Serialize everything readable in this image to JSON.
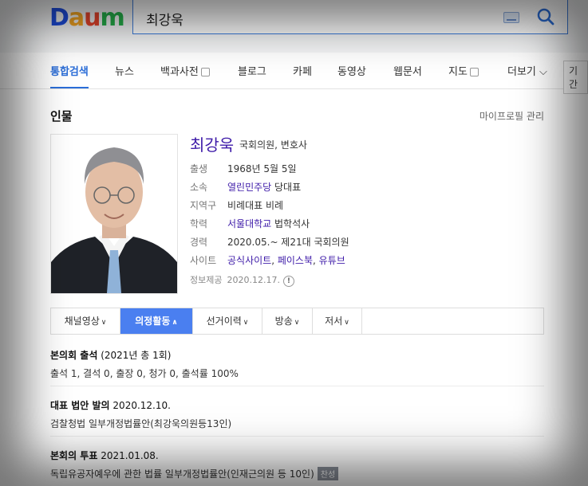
{
  "logo": {
    "letters": [
      "D",
      "a",
      "u",
      "m"
    ],
    "colors": [
      "#1e4ee0",
      "#f5a623",
      "#e8452c",
      "#26b14b"
    ]
  },
  "search": {
    "query": "최강욱"
  },
  "tabs": [
    {
      "label": "통합검색"
    },
    {
      "label": "뉴스"
    },
    {
      "label": "백과사전"
    },
    {
      "label": "블로그"
    },
    {
      "label": "카페"
    },
    {
      "label": "동영상"
    },
    {
      "label": "웹문서"
    },
    {
      "label": "지도"
    },
    {
      "label": "더보기"
    }
  ],
  "period_label": "기간",
  "section": {
    "title": "인물",
    "manage": "마이프로필 관리"
  },
  "person": {
    "name": "최강욱",
    "role": "국회의원, 변호사",
    "rows": [
      {
        "key": "출생",
        "value": "1968년 5월 5일"
      },
      {
        "key": "소속",
        "value_link": "열린민주당",
        "value": " 당대표"
      },
      {
        "key": "지역구",
        "value": "비례대표 비례"
      },
      {
        "key": "학력",
        "value_link": "서울대학교",
        "value": " 법학석사"
      },
      {
        "key": "경력",
        "value": "2020.05.~ 제21대 국회의원"
      },
      {
        "key": "사이트",
        "links": [
          "공식사이트",
          "페이스북",
          "유튜브"
        ]
      }
    ],
    "source_label": "정보제공",
    "source_date": "2020.12.17."
  },
  "subtabs": [
    {
      "label": "채널영상"
    },
    {
      "label": "의정활동"
    },
    {
      "label": "선거이력"
    },
    {
      "label": "방송"
    },
    {
      "label": "저서"
    }
  ],
  "records": [
    {
      "title": "본의회 출석",
      "meta": " (2021년 총 1회)",
      "desc": "출석 1, 결석 0, 출장 0, 청가 0, 출석률 100%"
    },
    {
      "title": "대표 법안 발의",
      "meta": " 2020.12.10.",
      "desc": "검찰청법 일부개정법률안(최강욱의원등13인)"
    },
    {
      "title": "본회의 투표",
      "meta": " 2021.01.08.",
      "desc": "독립유공자예우에 관한 법률 일부개정법률안(인재근의원 등 10인)",
      "badge": "찬성"
    }
  ]
}
